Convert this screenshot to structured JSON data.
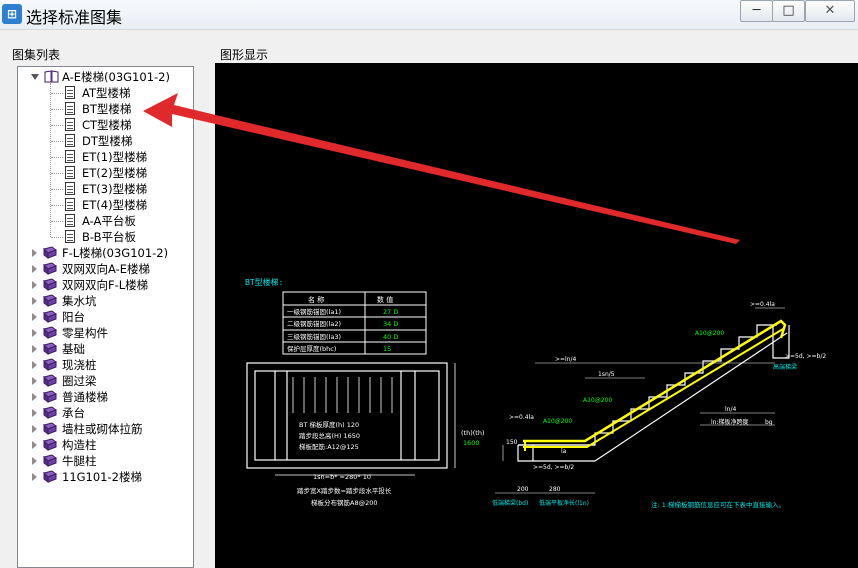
{
  "window": {
    "title": "选择标准图集",
    "icon_name": "app-icon",
    "min_symbol": "─",
    "max_symbol": "□",
    "close_symbol": "✕"
  },
  "panels": {
    "list_label": "图集列表",
    "display_label": "图形显示"
  },
  "tree": {
    "root": {
      "label": "A-E楼梯(03G101-2)",
      "icon": "open-book-icon",
      "expanded": true,
      "children": [
        {
          "label": "AT型楼梯"
        },
        {
          "label": "BT型楼梯"
        },
        {
          "label": "CT型楼梯"
        },
        {
          "label": "DT型楼梯"
        },
        {
          "label": "ET(1)型楼梯"
        },
        {
          "label": "ET(2)型楼梯"
        },
        {
          "label": "ET(3)型楼梯"
        },
        {
          "label": "ET(4)型楼梯"
        },
        {
          "label": "A-A平台板"
        },
        {
          "label": "B-B平台板"
        }
      ]
    },
    "others": [
      {
        "label": "F-L楼梯(03G101-2)"
      },
      {
        "label": "双网双向A-E楼梯"
      },
      {
        "label": "双网双向F-L楼梯"
      },
      {
        "label": "集水坑"
      },
      {
        "label": "阳台"
      },
      {
        "label": "零星构件"
      },
      {
        "label": "基础"
      },
      {
        "label": "现浇桩"
      },
      {
        "label": "圈过梁"
      },
      {
        "label": "普通楼梯"
      },
      {
        "label": "承台"
      },
      {
        "label": "墙柱或砌体拉筋"
      },
      {
        "label": "构造柱"
      },
      {
        "label": "牛腿柱"
      },
      {
        "label": "11G101-2楼梯"
      }
    ]
  },
  "drawing": {
    "title": "BT型楼梯:",
    "table": {
      "headers": [
        "名  称",
        "数  值"
      ],
      "rows": [
        [
          "一级钢筋锚固(la1)",
          "27 D"
        ],
        [
          "二级钢筋锚固(la2)",
          "34 D"
        ],
        [
          "三级钢筋锚固(la3)",
          "40 D"
        ],
        [
          "保护层厚度(bhc)",
          "15"
        ]
      ]
    },
    "plan_notes": [
      "BT 梯板厚度(h) 120",
      "踏步段总高(H) 1650",
      "梯板配筋:A12@125"
    ],
    "plan_dim": "(th)(th)",
    "plan_dim_value": "1600",
    "plan_bottom_1": "1sn=b* =280* 10",
    "plan_bottom_2": "踏步宽X踏步数=踏步段水平投长",
    "plan_bottom_3": "梯板分布钢筋A8@200",
    "section": {
      "labels": {
        "top_ln4": ">=ln/4",
        "ln5": "1sn/5",
        "top_right": ">=0.4la",
        "bar1": "A10@200",
        "bar2": "A10@200",
        "bar3": "A10@200",
        "left_la": ">=0.4la",
        "left_bar": "A10@200",
        "d5_left": ">=5d, >=b/2",
        "d5_right": ">=5d, >=b/2",
        "high_end": "高端梯梁",
        "ln4_right": "ln/4",
        "ln_slab": "ln:梯板净跨度",
        "bg": "bg",
        "la_bottom": "la",
        "dim_200": "200",
        "dim_280": "280",
        "low_end": "低端梯梁(bd)",
        "low_slab": "低端平板净长(l1n)",
        "h150": "150",
        "h200": "200"
      }
    },
    "note": "注: 1.梯梯板钢筋信息应可在下表中直接输入。"
  },
  "colors": {
    "title_gradient_top": "#f7f9fc",
    "canvas_bg": "#000000",
    "cad_white": "#ffffff",
    "cad_cyan": "#00e5e5",
    "cad_yellow": "#ffff00",
    "cad_green": "#00ff00",
    "arrow_red": "#e0292a"
  }
}
